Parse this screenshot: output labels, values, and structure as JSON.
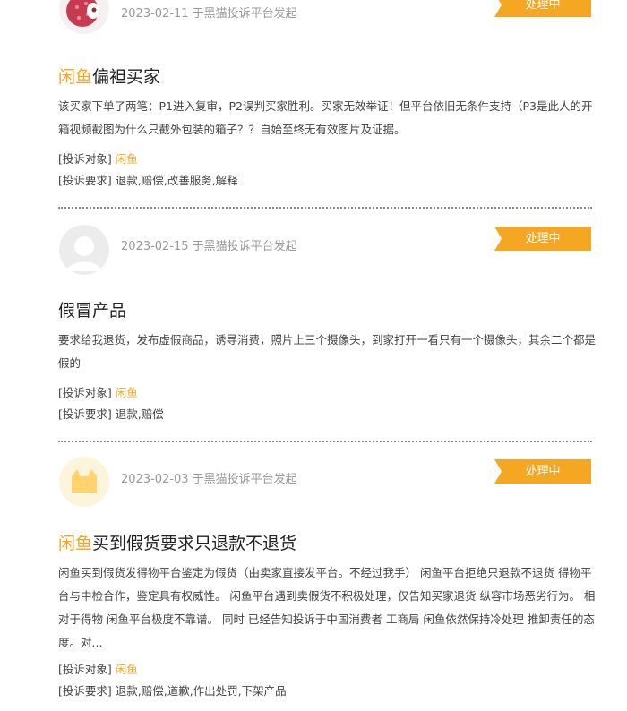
{
  "posts": [
    {
      "date_source": "2023-02-11 于黑猫投诉平台发起",
      "status": "处理中",
      "title_brand": "闲鱼",
      "title_rest": "偏袒买家",
      "description": "该买家下单了两笔：P1进入复审，P2误判买家胜利。买家无效举证！但平台依旧无条件支持（P3是此人的开箱视频截图为什么只截外包装的箱子？？自始至终无有效图片及证据。",
      "target_label": "[投诉对象]",
      "target_value": "闲鱼",
      "request_label": "[投诉要求]",
      "request_value": "退款,赔偿,改善服务,解释",
      "avatar": "lychee-avatar"
    },
    {
      "date_source": "2023-02-15 于黑猫投诉平台发起",
      "status": "处理中",
      "title_brand": "",
      "title_rest": "假冒产品",
      "description": "要求给我退货，发布虚假商品，诱导消费，照片上三个摄像头，到家打开一看只有一个摄像头，其余二个都是假的",
      "target_label": "[投诉对象]",
      "target_value": "闲鱼",
      "request_label": "[投诉要求]",
      "request_value": "退款,赔偿",
      "avatar": "default-user-avatar"
    },
    {
      "date_source": "2023-02-03 于黑猫投诉平台发起",
      "status": "处理中",
      "title_brand": "闲鱼",
      "title_rest": "买到假货要求只退款不退货",
      "description": "闲鱼买到假货发得物平台鉴定为假货（由卖家直接发平台。不经过我手） 闲鱼平台拒绝只退款不退货 得物平台与中检合作，鉴定具有权威性。 闲鱼平台遇到卖假货不积极处理，仅告知买家退货 纵容市场恶劣行为。 相对于得物 闲鱼平台极度不靠谱。 同时 已经告知投诉于中国消费者 工商局 闲鱼依然保持冷处理 推卸责任的态度。对...",
      "target_label": "[投诉对象]",
      "target_value": "闲鱼",
      "request_label": "[投诉要求]",
      "request_value": "退款,赔偿,道歉,作出处罚,下架产品",
      "avatar": "cat-avatar"
    }
  ],
  "colors": {
    "accent": "#f5a623",
    "text": "#333333",
    "meta": "#999999"
  }
}
